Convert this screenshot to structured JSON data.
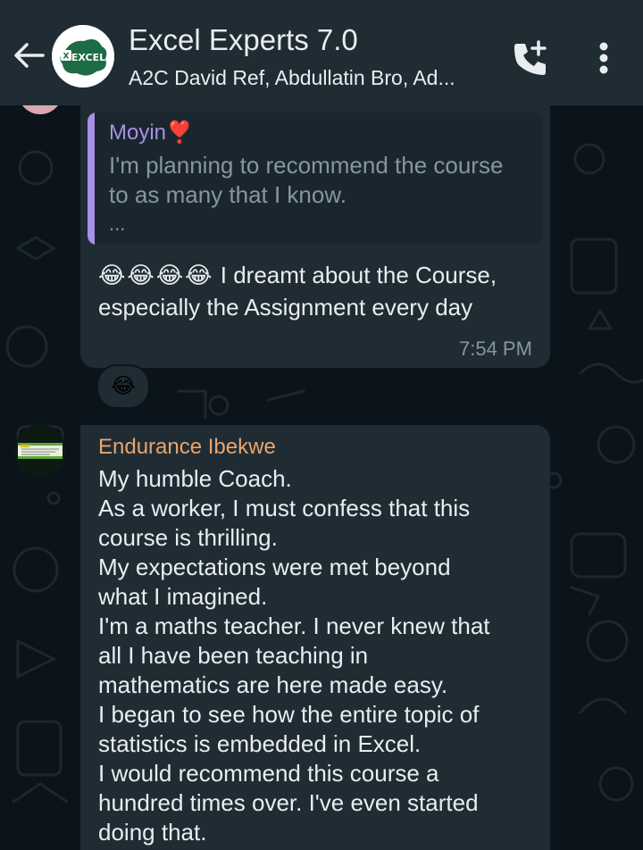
{
  "header": {
    "title": "Excel Experts 7.0",
    "subtitle": "A2C David Ref, Abdullatin Bro, Ad...",
    "icons": {
      "back": "arrow-left-icon",
      "call": "add-call-icon",
      "menu": "more-vertical-icon"
    },
    "avatar_text": "EXCEL"
  },
  "messages": [
    {
      "quoted": {
        "author": "Moyin❣️",
        "text": "I'm planning to recommend the course to as many that I know.",
        "more": "..."
      },
      "text": "I dreamt about the Course, especially the Assignment every day",
      "emoji_prefix": "😂😂😂😂",
      "time": "7:54 PM",
      "reaction": "😂"
    },
    {
      "sender": "Endurance Ibekwe",
      "lines": [
        "My humble Coach.",
        "As a worker, I must confess that this",
        "course is thrilling.",
        "My expectations were met beyond",
        "what I imagined.",
        "I'm a maths teacher. I never knew that",
        "all I have been teaching in",
        "mathematics are here made easy.",
        "I began to see how the entire topic of",
        "statistics is embedded in Excel.",
        "I would recommend this course a",
        "hundred times over. I've even started",
        "doing that."
      ]
    }
  ],
  "colors": {
    "background": "#0b141a",
    "header": "#202c33",
    "bubble": "#1f2c33",
    "quote_accent": "#a791e6",
    "sender_name": "#e8a56d",
    "text": "#e9edef",
    "muted": "#8696a0"
  }
}
